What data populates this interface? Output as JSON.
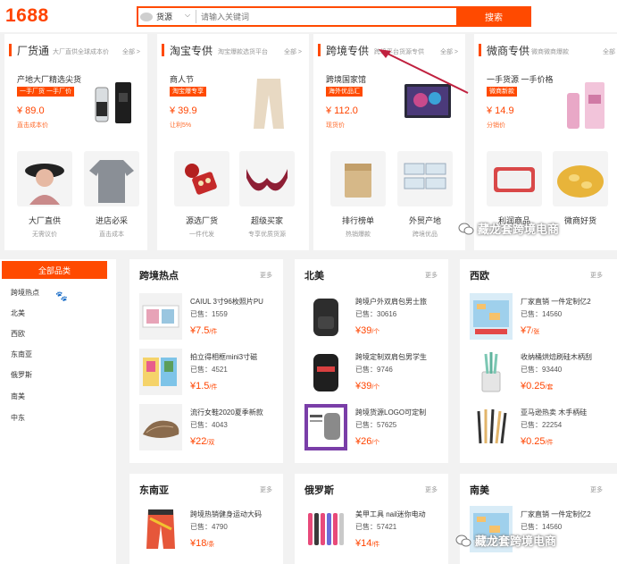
{
  "header": {
    "logo": "1688",
    "search_type": "货源",
    "search_placeholder": "请输入关键词",
    "search_button": "搜索"
  },
  "categories": [
    {
      "title": "厂货通",
      "subtitle": "大厂直供全球成本价",
      "more": "全部 >",
      "featured": {
        "name": "产地大厂精选尖货",
        "tag": "一手厂货 一手厂价",
        "price": "¥ 89.0",
        "note": "直击成本价"
      },
      "items": [
        {
          "label": "大厂直供",
          "sub": "无需议价"
        },
        {
          "label": "进店必采",
          "sub": "直击成本"
        }
      ]
    },
    {
      "title": "淘宝专供",
      "subtitle": "淘宝爆款选货平台",
      "more": "全部 >",
      "featured": {
        "name": "商人节",
        "tag": "淘宝爆专享",
        "price": "¥ 39.9",
        "note": "让利5%"
      },
      "items": [
        {
          "label": "源选厂货",
          "sub": "一件代发"
        },
        {
          "label": "超级买家",
          "sub": "专享优质货源"
        }
      ]
    },
    {
      "title": "跨境专供",
      "subtitle": "跨境平台货源专供",
      "more": "全部 >",
      "featured": {
        "name": "跨境国家馆",
        "tag": "海外优品汇",
        "price": "¥ 112.0",
        "note": "现货价"
      },
      "items": [
        {
          "label": "排行榜单",
          "sub": "热销爆款"
        },
        {
          "label": "外贸产地",
          "sub": "跨境优品"
        }
      ]
    },
    {
      "title": "微商专供",
      "subtitle": "微商微商爆款",
      "more": "全部 >",
      "featured": {
        "name": "一手货源 一手价格",
        "tag": "微商新款",
        "price": "¥ 14.9",
        "note": "分销价"
      },
      "items": [
        {
          "label": "利润商品",
          "sub": ""
        },
        {
          "label": "微商好货",
          "sub": ""
        }
      ]
    }
  ],
  "sidebar": {
    "header": "全部品类",
    "items": [
      "跨境热点",
      "北美",
      "西欧",
      "东南亚",
      "俄罗斯",
      "南美",
      "中东"
    ]
  },
  "panels": [
    {
      "title": "跨境热点",
      "more": "更多",
      "products": [
        {
          "name": "CAIUL 3寸96枚照片PU",
          "sold": "已售：1559",
          "price": "¥7.5",
          "unit": "/件"
        },
        {
          "name": "拍立得相框mini3寸磁",
          "sold": "已售：4521",
          "price": "¥1.5",
          "unit": "/件"
        },
        {
          "name": "流行女鞋2020夏季新款",
          "sold": "已售：4043",
          "price": "¥22",
          "unit": "/双"
        }
      ]
    },
    {
      "title": "北美",
      "more": "更多",
      "products": [
        {
          "name": "跨境户外双肩包男士旅",
          "sold": "已售：30616",
          "price": "¥39",
          "unit": "/个"
        },
        {
          "name": "跨境定制双肩包男学生",
          "sold": "已售：9746",
          "price": "¥39",
          "unit": "/个"
        },
        {
          "name": "跨境货源LOGO可定制",
          "sold": "已售：57625",
          "price": "¥26",
          "unit": "/个"
        }
      ]
    },
    {
      "title": "西欧",
      "more": "更多",
      "products": [
        {
          "name": "厂家直销 一件定制亿2",
          "sold": "已售：14560",
          "price": "¥7",
          "unit": "/张"
        },
        {
          "name": "收纳桶烘焙刷硅木柄刮",
          "sold": "已售：93440",
          "price": "¥0.25",
          "unit": "/套"
        },
        {
          "name": "亚马逊热卖 木手柄硅",
          "sold": "已售：22254",
          "price": "¥0.25",
          "unit": "/件"
        }
      ]
    },
    {
      "title": "东南亚",
      "more": "更多",
      "products": [
        {
          "name": "跨境热销健身运动大码",
          "sold": "已售：4790",
          "price": "¥18",
          "unit": "/条"
        }
      ]
    },
    {
      "title": "俄罗斯",
      "more": "更多",
      "products": [
        {
          "name": "美甲工具 nail迷你电动",
          "sold": "已售：57421",
          "price": "¥14",
          "unit": "/件"
        }
      ]
    },
    {
      "title": "南美",
      "more": "更多",
      "products": [
        {
          "name": "厂家直销 一件定制亿2",
          "sold": "已售：14560",
          "price": "",
          "unit": ""
        }
      ]
    }
  ],
  "watermark": "藏龙套跨境电商",
  "colors": {
    "brand": "#ff4a00",
    "price": "#ff4400",
    "annotation_arrow": "#c0213f"
  }
}
